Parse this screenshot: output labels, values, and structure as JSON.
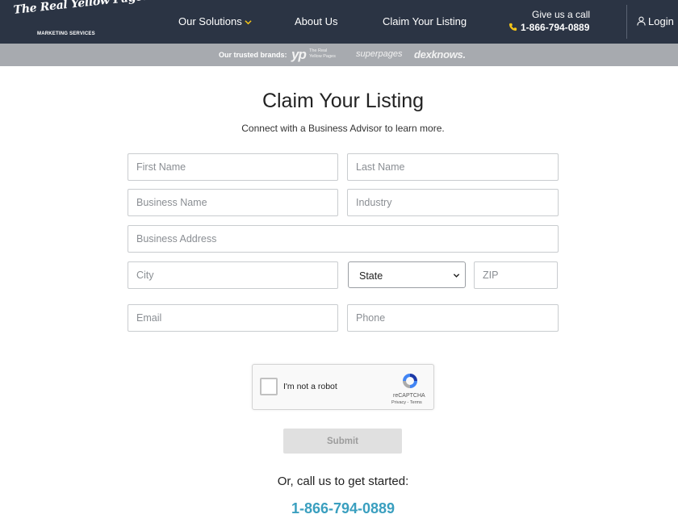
{
  "header": {
    "logo_text": "The Real Yellow Pages",
    "logo_sub": "MARKETING SERVICES",
    "nav": {
      "solutions": "Our Solutions",
      "about": "About Us",
      "claim": "Claim Your Listing"
    },
    "call_label": "Give us a call",
    "call_phone": "1-866-794-0889",
    "login": "Login",
    "accent_color": "#f5c518",
    "background_color": "#2b3444"
  },
  "brands": {
    "label": "Our trusted brands:",
    "yp_mark": "yp",
    "yp_line1": "The Real",
    "yp_line2": "Yellow Pages",
    "superpages": "superpages",
    "dexknows": "dexknows."
  },
  "main": {
    "title": "Claim Your Listing",
    "subtitle": "Connect with a Business Advisor to learn more."
  },
  "form": {
    "first_name": {
      "placeholder": "First Name",
      "value": ""
    },
    "last_name": {
      "placeholder": "Last Name",
      "value": ""
    },
    "business_name": {
      "placeholder": "Business Name",
      "value": ""
    },
    "industry": {
      "placeholder": "Industry",
      "value": ""
    },
    "business_address": {
      "placeholder": "Business Address",
      "value": ""
    },
    "city": {
      "placeholder": "City",
      "value": ""
    },
    "state": {
      "selected": "State"
    },
    "zip": {
      "placeholder": "ZIP",
      "value": ""
    },
    "email": {
      "placeholder": "Email",
      "value": ""
    },
    "phone": {
      "placeholder": "Phone",
      "value": ""
    }
  },
  "captcha": {
    "label": "I'm not a robot",
    "brand": "reCAPTCHA",
    "terms": "Privacy - Terms"
  },
  "submit_label": "Submit",
  "footer": {
    "or_call": "Or, call us to get started:",
    "phone": "1-866-794-0889",
    "phone_color": "#3a9fbf"
  }
}
